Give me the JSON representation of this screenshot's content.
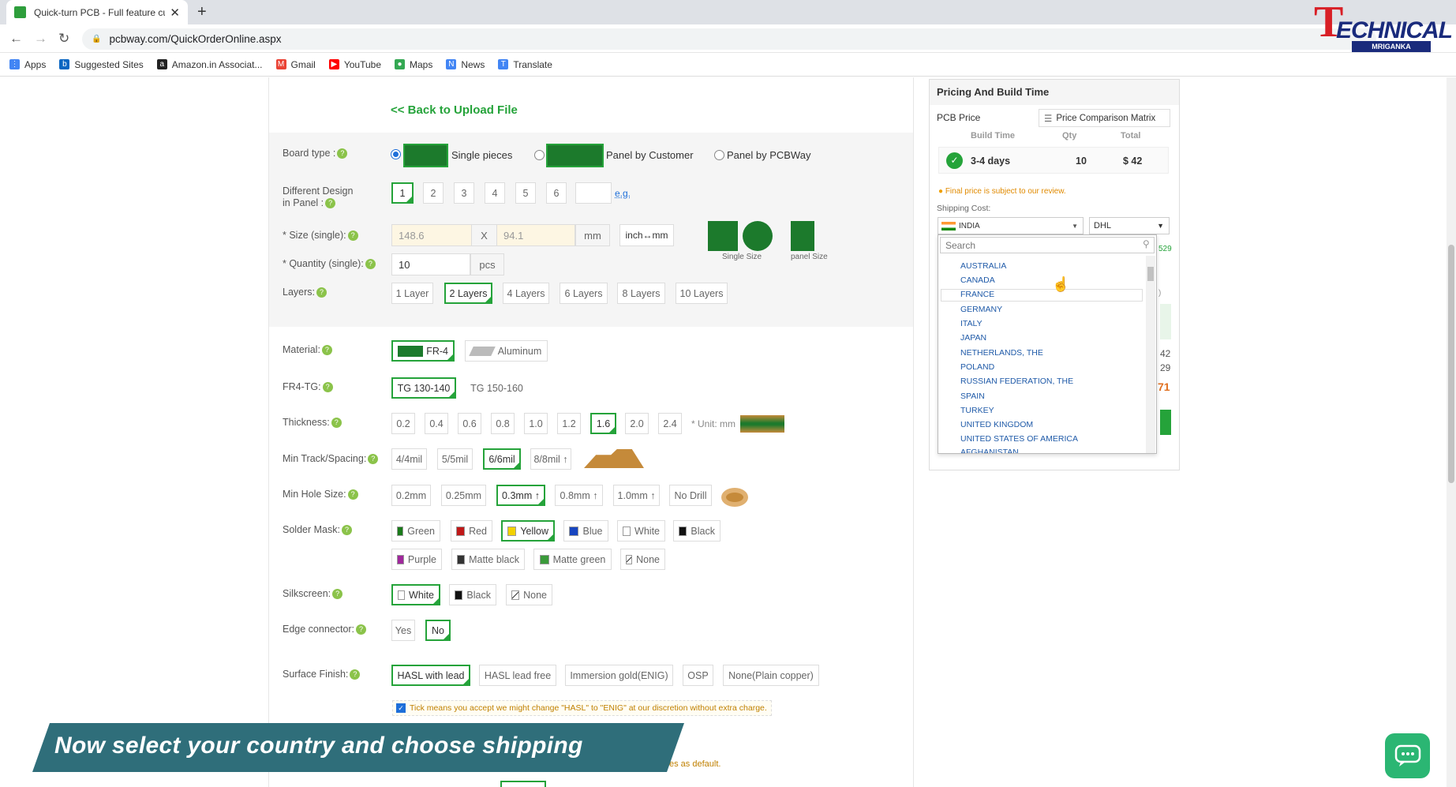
{
  "browser": {
    "tab_title": "Quick-turn PCB - Full feature cus",
    "url": "pcbway.com/QuickOrderOnline.aspx",
    "bookmarks": [
      "Apps",
      "Suggested Sites",
      "Amazon.in Associat...",
      "Gmail",
      "YouTube",
      "Maps",
      "News",
      "Translate"
    ]
  },
  "watermark": {
    "letter": "T",
    "word": "ECHNICAL",
    "sub": "MRIGANKA"
  },
  "form": {
    "back_link": "<< Back to Upload File",
    "board_type": {
      "label": "Board type :",
      "options": [
        "Single pieces",
        "Panel by Customer",
        "Panel by PCBWay"
      ],
      "selected": "Single pieces"
    },
    "design": {
      "label": "Different Design in Panel :",
      "options": [
        "1",
        "2",
        "3",
        "4",
        "5",
        "6"
      ],
      "selected": "1",
      "eg": "e.g."
    },
    "size": {
      "label": "* Size (single):",
      "w": "148.6",
      "x": "X",
      "h": "94.1",
      "unit": "mm",
      "toggle": "inch↔mm",
      "single_caption": "Single Size",
      "panel_caption": "panel Size"
    },
    "quantity": {
      "label": "* Quantity (single):",
      "value": "10",
      "unit": "pcs"
    },
    "layers": {
      "label": "Layers:",
      "options": [
        "1 Layer",
        "2 Layers",
        "4 Layers",
        "6 Layers",
        "8 Layers",
        "10 Layers"
      ],
      "selected": "2 Layers"
    },
    "material": {
      "label": "Material:",
      "options": [
        "FR-4",
        "Aluminum"
      ],
      "selected": "FR-4"
    },
    "fr4tg": {
      "label": "FR4-TG:",
      "options": [
        "TG 130-140",
        "TG 150-160"
      ],
      "selected": "TG 130-140"
    },
    "thickness": {
      "label": "Thickness:",
      "options": [
        "0.2",
        "0.4",
        "0.6",
        "0.8",
        "1.0",
        "1.2",
        "1.6",
        "2.0",
        "2.4"
      ],
      "selected": "1.6",
      "unit": "* Unit: mm"
    },
    "track": {
      "label": "Min Track/Spacing:",
      "options": [
        "4/4mil",
        "5/5mil",
        "6/6mil",
        "8/8mil ↑"
      ],
      "selected": "6/6mil"
    },
    "hole": {
      "label": "Min Hole Size:",
      "options": [
        "0.2mm",
        "0.25mm",
        "0.3mm ↑",
        "0.8mm ↑",
        "1.0mm ↑",
        "No Drill"
      ],
      "selected": "0.3mm ↑"
    },
    "mask": {
      "label": "Solder Mask:",
      "row1": [
        {
          "n": "Green",
          "c": "#1a7a1a"
        },
        {
          "n": "Red",
          "c": "#c01818"
        },
        {
          "n": "Yellow",
          "c": "#f2d100"
        },
        {
          "n": "Blue",
          "c": "#1846c0"
        },
        {
          "n": "White",
          "c": "#ffffff"
        },
        {
          "n": "Black",
          "c": "#111111"
        }
      ],
      "row2": [
        {
          "n": "Purple",
          "c": "#a0289c"
        },
        {
          "n": "Matte black",
          "c": "#333333"
        },
        {
          "n": "Matte green",
          "c": "#3a9a3a"
        },
        {
          "n": "None",
          "c": "#ffffff"
        }
      ],
      "selected": "Yellow"
    },
    "silk": {
      "label": "Silkscreen:",
      "options": [
        {
          "n": "White",
          "c": "#ffffff"
        },
        {
          "n": "Black",
          "c": "#111111"
        },
        {
          "n": "None",
          "c": "#ffffff"
        }
      ],
      "selected": "White"
    },
    "edge": {
      "label": "Edge connector:",
      "options": [
        "Yes",
        "No"
      ],
      "selected": "No"
    },
    "finish": {
      "label": "Surface Finish:",
      "options": [
        "HASL with lead",
        "HASL lead free",
        "Immersion gold(ENIG)",
        "OSP",
        "None(Plain copper)"
      ],
      "selected": "HASL with lead"
    },
    "tick_note": "Tick means you accept we might change \"HASL\" to \"ENIG\" at our discretion without extra charge.",
    "default_note": "es as default."
  },
  "pricing": {
    "title": "Pricing And Build Time",
    "pcb_price": "PCB Price",
    "matrix_btn": "Price Comparison Matrix",
    "cols": [
      "Build Time",
      "Qty",
      "Total"
    ],
    "row": {
      "time": "3-4 days",
      "qty": "10",
      "total": "$ 42"
    },
    "note": "Final price is subject to our review.",
    "shipping_label": "Shipping Cost:",
    "country": "INDIA",
    "carrier": "DHL",
    "search_placeholder": "Search",
    "partial_right": [
      "529",
      ")",
      "42",
      "29",
      "71"
    ],
    "countries": [
      "AUSTRALIA",
      "CANADA",
      "FRANCE",
      "GERMANY",
      "ITALY",
      "JAPAN",
      "NETHERLANDS, THE",
      "POLAND",
      "RUSSIAN FEDERATION, THE",
      "SPAIN",
      "TURKEY",
      "UNITED KINGDOM",
      "UNITED STATES OF AMERICA",
      "AFGHANISTAN"
    ],
    "highlighted": "FRANCE"
  },
  "caption": "Now select your country and choose shipping"
}
